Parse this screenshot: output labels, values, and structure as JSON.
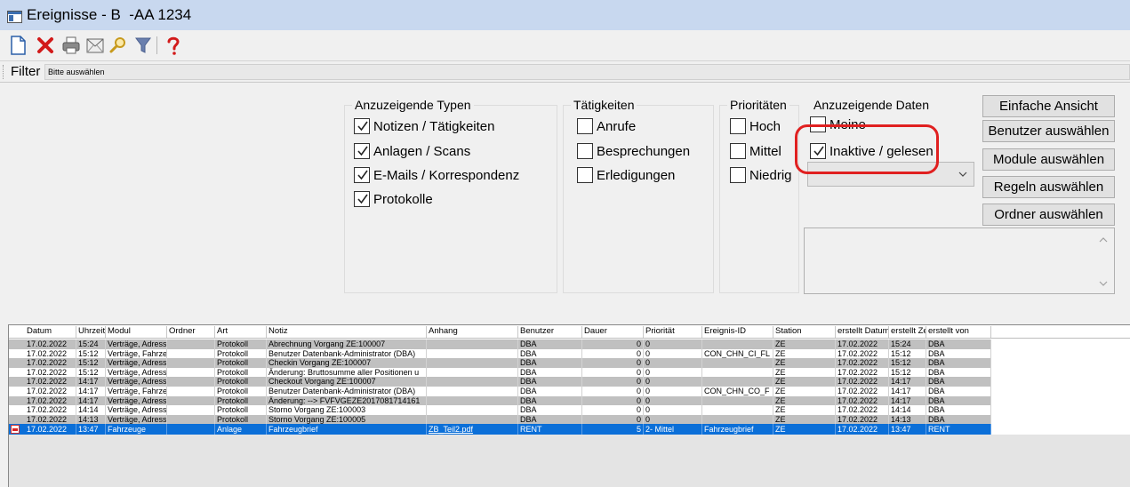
{
  "window": {
    "title": "Ereignisse - B  -AA 1234"
  },
  "toolbar": {
    "items": [
      "new-document-icon",
      "delete-icon",
      "print-icon",
      "email-icon",
      "search-icon",
      "filter-icon",
      "help-icon"
    ]
  },
  "filter": {
    "label": "Filter",
    "placeholder": "Bitte auswählen"
  },
  "types_group": {
    "title": "Anzuzeigende Typen",
    "items": [
      {
        "label": "Notizen / Tätigkeiten",
        "checked": true
      },
      {
        "label": "Anlagen / Scans",
        "checked": true
      },
      {
        "label": "E-Mails / Korrespondenz",
        "checked": true
      },
      {
        "label": "Protokolle",
        "checked": true
      }
    ]
  },
  "activities_group": {
    "title": "Tätigkeiten",
    "items": [
      {
        "label": "Anrufe",
        "checked": false
      },
      {
        "label": "Besprechungen",
        "checked": false
      },
      {
        "label": "Erledigungen",
        "checked": false
      }
    ]
  },
  "priorities_group": {
    "title": "Prioritäten",
    "items": [
      {
        "label": "Hoch",
        "checked": false
      },
      {
        "label": "Mittel",
        "checked": false
      },
      {
        "label": "Niedrig",
        "checked": false
      }
    ]
  },
  "data_group": {
    "title": "Anzuzeigende Daten",
    "items": [
      {
        "label": "Meine",
        "checked": false
      },
      {
        "label": "Inaktive / gelesen",
        "checked": true
      }
    ],
    "combo_value": ""
  },
  "buttons": {
    "simple_view": "Einfache Ansicht",
    "select_user": "Benutzer auswählen",
    "select_modules": "Module auswählen",
    "select_rules": "Regeln auswählen",
    "select_folder": "Ordner auswählen"
  },
  "grid": {
    "columns": [
      "Datum",
      "Uhrzeit",
      "Modul",
      "Ordner",
      "Art",
      "Notiz",
      "Anhang",
      "Benutzer",
      "Dauer",
      "Priorität",
      "Ereignis-ID",
      "Station",
      "erstellt Datum",
      "erstellt Zeit",
      "erstellt von"
    ],
    "rows": [
      [
        "17.02.2022",
        "15:24",
        "Verträge, Adressen",
        "",
        "Protokoll",
        "Abrechnung Vorgang ZE:100007",
        "",
        "DBA",
        "0",
        "0",
        "",
        "ZE",
        "17.02.2022",
        "15:24",
        "DBA"
      ],
      [
        "17.02.2022",
        "15:12",
        "Verträge, Fahrzeuge",
        "",
        "Protokoll",
        "Benutzer Datenbank-Administrator (DBA) ",
        "",
        "DBA",
        "0",
        "0",
        "CON_CHN_CI_FL",
        "ZE",
        "17.02.2022",
        "15:12",
        "DBA"
      ],
      [
        "17.02.2022",
        "15:12",
        "Verträge, Adressen",
        "",
        "Protokoll",
        "Checkin Vorgang ZE:100007",
        "",
        "DBA",
        "0",
        "0",
        "",
        "ZE",
        "17.02.2022",
        "15:12",
        "DBA"
      ],
      [
        "17.02.2022",
        "15:12",
        "Verträge, Adressen",
        "",
        "Protokoll",
        "Änderung:  Bruttosumme aller Positionen u",
        "",
        "DBA",
        "0",
        "0",
        "",
        "ZE",
        "17.02.2022",
        "15:12",
        "DBA"
      ],
      [
        "17.02.2022",
        "14:17",
        "Verträge, Adressen",
        "",
        "Protokoll",
        "Checkout Vorgang ZE:100007",
        "",
        "DBA",
        "0",
        "0",
        "",
        "ZE",
        "17.02.2022",
        "14:17",
        "DBA"
      ],
      [
        "17.02.2022",
        "14:17",
        "Verträge, Fahrzeuge",
        "",
        "Protokoll",
        "Benutzer Datenbank-Administrator (DBA) ",
        "",
        "DBA",
        "0",
        "0",
        "CON_CHN_CO_F",
        "ZE",
        "17.02.2022",
        "14:17",
        "DBA"
      ],
      [
        "17.02.2022",
        "14:17",
        "Verträge, Adressen",
        "",
        "Protokoll",
        "Änderung:  --> FVFVGEZE2017081714161",
        "",
        "DBA",
        "0",
        "0",
        "",
        "ZE",
        "17.02.2022",
        "14:17",
        "DBA"
      ],
      [
        "17.02.2022",
        "14:14",
        "Verträge, Adressen",
        "",
        "Protokoll",
        "Storno Vorgang ZE:100003",
        "",
        "DBA",
        "0",
        "0",
        "",
        "ZE",
        "17.02.2022",
        "14:14",
        "DBA"
      ],
      [
        "17.02.2022",
        "14:13",
        "Verträge, Adressen",
        "",
        "Protokoll",
        "Storno Vorgang ZE:100005",
        "",
        "DBA",
        "0",
        "0",
        "",
        "ZE",
        "17.02.2022",
        "14:13",
        "DBA"
      ],
      [
        "17.02.2022",
        "13:47",
        "Fahrzeuge",
        "",
        "Anlage",
        "Fahrzeugbrief",
        "ZB_Teil2.pdf",
        "RENT",
        "5",
        "2- Mittel",
        "Fahrzeugbrief",
        "ZE",
        "17.02.2022",
        "13:47",
        "RENT"
      ]
    ],
    "selected_row": 9
  },
  "colors": {
    "titlebar": "#c8d8ef",
    "selection": "#0b6fd8",
    "highlight": "#e02020",
    "row_gray": "#c0c0c0"
  }
}
